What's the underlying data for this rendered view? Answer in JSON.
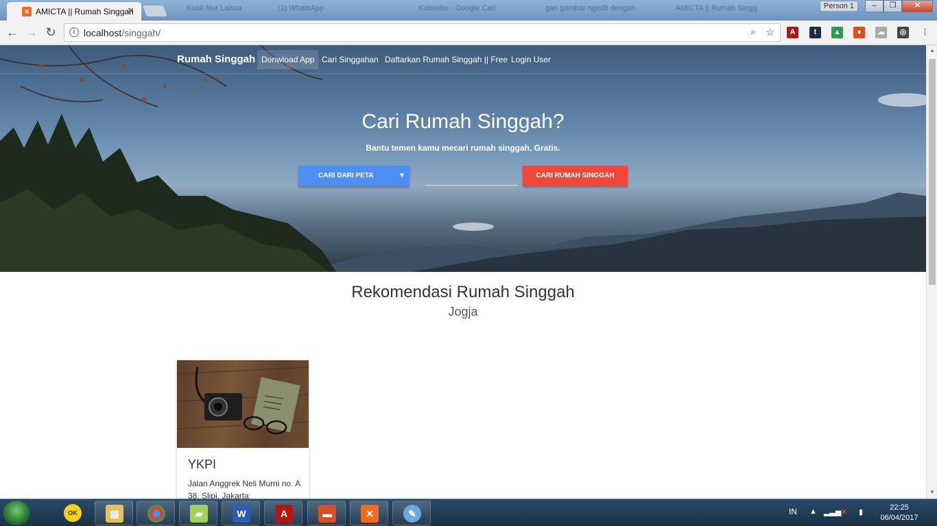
{
  "browser": {
    "active_tab_title": "AMICTA || Rumah Singgah",
    "background_tabs": [
      "Kuak Nur Laissa",
      "(1) WhatsApp",
      "Kalender - Google Cari",
      "gan gambar ngedit dengan",
      "AMICTA || Rumah Singg"
    ],
    "profile": "Person 1",
    "url_host": "localhost",
    "url_path": "/singgah/"
  },
  "site": {
    "brand": "Rumah Singgah",
    "nav": [
      "Donwload App",
      "Cari Singgahan",
      "Daftarkan Rumah Singgah || Free",
      "Login User"
    ],
    "hero_title": "Cari Rumah Singgah?",
    "hero_subtitle": "Bantu temen kamu mecari rumah singgah, Gratis.",
    "map_select_label": "CARI DARI PETA",
    "search_placeholder": "",
    "search_button": "CARI RUMAH SINGGAH",
    "section_title": "Rekomendasi Rumah Singgah",
    "section_subtitle": "Jogja",
    "card": {
      "title": "YKPI",
      "address": "Jalan Anggrek Neli Murni no. A 38, Slipi, Jakarta"
    }
  },
  "taskbar": {
    "language": "IN",
    "time": "22:25",
    "date": "06/04/2017"
  }
}
